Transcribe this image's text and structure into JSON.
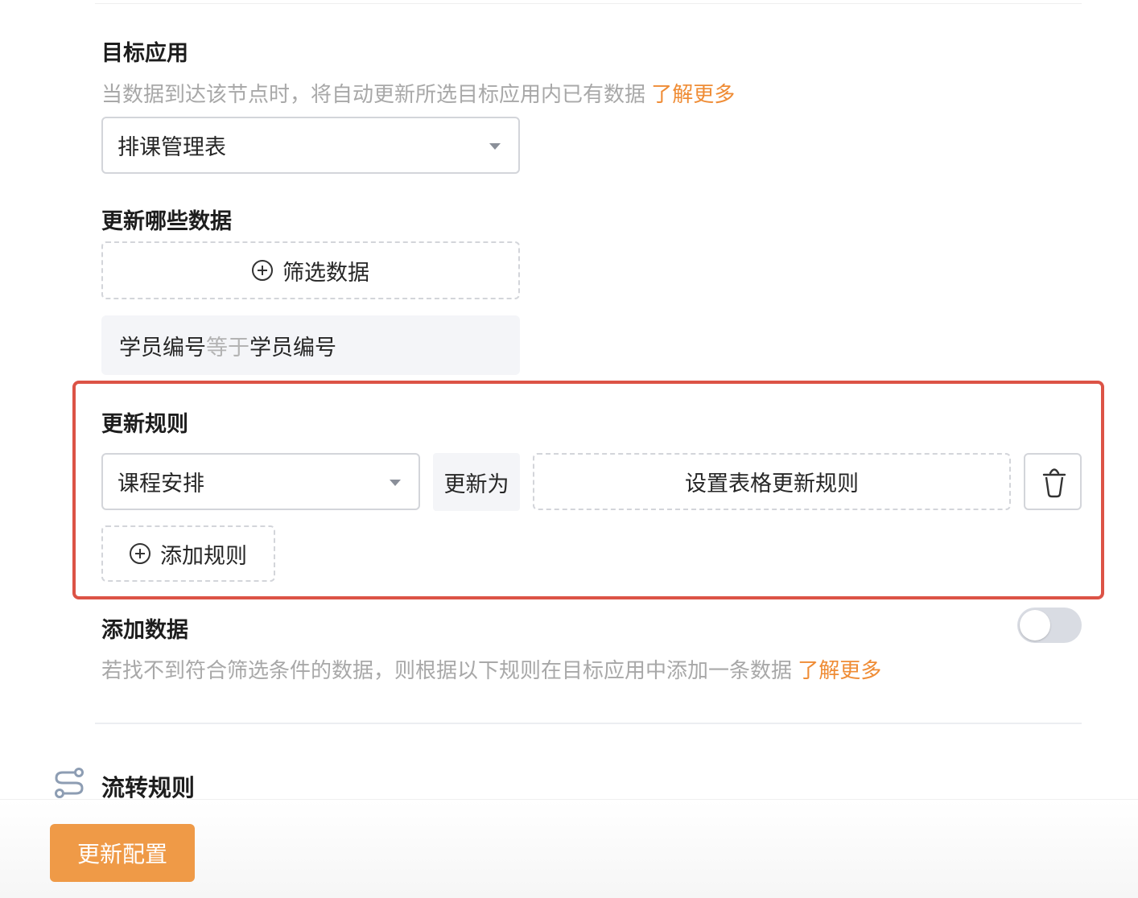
{
  "target_app": {
    "title": "目标应用",
    "description": "当数据到达该节点时，将自动更新所选目标应用内已有数据",
    "learn_more": "了解更多",
    "selected": "排课管理表"
  },
  "which_data": {
    "title": "更新哪些数据",
    "filter_button": "筛选数据",
    "condition": {
      "field": "学员编号",
      "operator": "等于",
      "value": "学员编号"
    }
  },
  "update_rules": {
    "title": "更新规则",
    "rules": [
      {
        "field": "课程安排",
        "op_label": "更新为",
        "value_button": "设置表格更新规则",
        "delete_icon": "trash-icon"
      }
    ],
    "add_rule_button": "添加规则"
  },
  "add_data": {
    "title": "添加数据",
    "description": "若找不到符合筛选条件的数据，则根据以下规则在目标应用中添加一条数据",
    "learn_more": "了解更多",
    "toggle_on": false
  },
  "flow_rules": {
    "title": "流转规则",
    "icon": "route-icon"
  },
  "footer": {
    "primary_button": "更新配置"
  },
  "colors": {
    "accent": "#ef8c35",
    "primary_button": "#ef9a47",
    "highlight_border": "#dc5346"
  }
}
